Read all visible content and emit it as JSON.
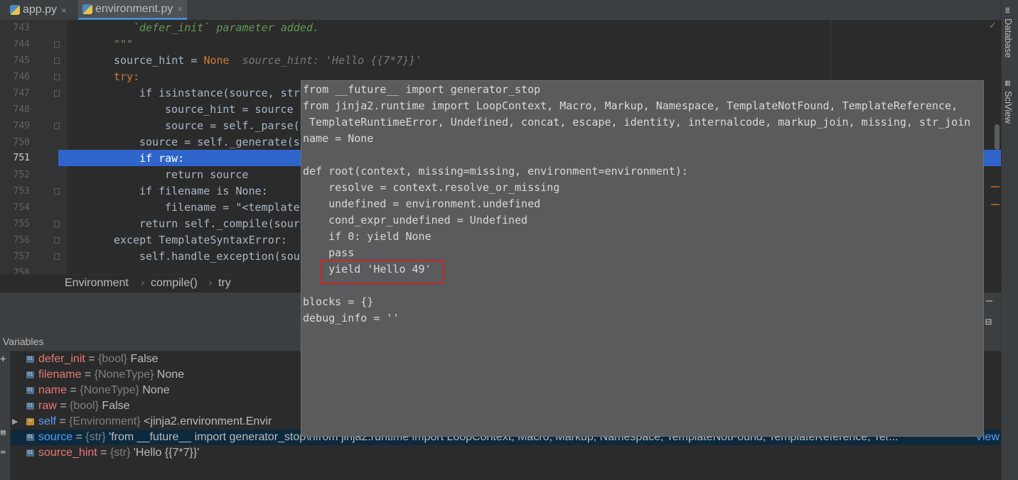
{
  "tabs": [
    {
      "label": "app.py",
      "close": "×"
    },
    {
      "label": "environment.py",
      "close": "×"
    }
  ],
  "editor": {
    "lines": [
      {
        "num": "743",
        "text": "`defer_init` parameter added."
      },
      {
        "num": "744",
        "text": "\"\"\""
      },
      {
        "num": "745",
        "kw": "source_hint = ",
        "val": "None",
        "hint": "source_hint: 'Hello {{7*7}}'"
      },
      {
        "num": "746",
        "text": "try:"
      },
      {
        "num": "747",
        "text": "if isinstance(source, str"
      },
      {
        "num": "748",
        "text": "source_hint = source"
      },
      {
        "num": "749",
        "text": "source = self._parse(s"
      },
      {
        "num": "750",
        "text": "source = self._generate(s"
      },
      {
        "num": "751",
        "text": "if raw:"
      },
      {
        "num": "752",
        "text": "return source"
      },
      {
        "num": "753",
        "text": "if filename is None:"
      },
      {
        "num": "754",
        "text": "filename = \"<template"
      },
      {
        "num": "755",
        "text": "return self._compile(sour"
      },
      {
        "num": "756",
        "text": "except TemplateSyntaxError:"
      },
      {
        "num": "757",
        "text": "self.handle_exception(sou"
      },
      {
        "num": "758",
        "text": ""
      }
    ]
  },
  "breadcrumb": [
    "Environment",
    "compile()",
    "try"
  ],
  "variables_header": "Variables",
  "variables": [
    {
      "name": "defer_init",
      "eq": " = ",
      "type": "{bool}",
      "value": " False"
    },
    {
      "name": "filename",
      "eq": " = ",
      "type": "{NoneType}",
      "value": " None"
    },
    {
      "name": "name",
      "eq": " = ",
      "type": "{NoneType}",
      "value": " None"
    },
    {
      "name": "raw",
      "eq": " = ",
      "type": "{bool}",
      "value": " False"
    },
    {
      "name": "self",
      "eq": " = ",
      "type": "{Environment}",
      "value": " <jinja2.environment.Envir"
    },
    {
      "name": "source",
      "eq": " = ",
      "type": "{str}",
      "value": " 'from __future__ import generator_stop\\nfrom jinja2.runtime import LoopContext, Macro, Markup, Namespace, TemplateNotFound, TemplateReference, Ter...",
      "link": "View"
    },
    {
      "name": "source_hint",
      "eq": " = ",
      "type": "{str}",
      "value": " 'Hello {{7*7}}'"
    }
  ],
  "popup": {
    "lines": [
      "from __future__ import generator_stop",
      "from jinja2.runtime import LoopContext, Macro, Markup, Namespace, TemplateNotFound, TemplateReference,",
      " TemplateRuntimeError, Undefined, concat, escape, identity, internalcode, markup_join, missing, str_join",
      "name = None",
      "",
      "def root(context, missing=missing, environment=environment):",
      "    resolve = context.resolve_or_missing",
      "    undefined = environment.undefined",
      "    cond_expr_undefined = Undefined",
      "    if 0: yield None",
      "    pass",
      "    yield 'Hello 49'",
      "",
      "blocks = {}",
      "debug_info = ''"
    ]
  },
  "right_tabs": [
    "Database",
    "SciView"
  ],
  "colors": {
    "highlight": "#2f65ca",
    "redbox": "#c62828",
    "popup_bg": "#595b5d"
  }
}
